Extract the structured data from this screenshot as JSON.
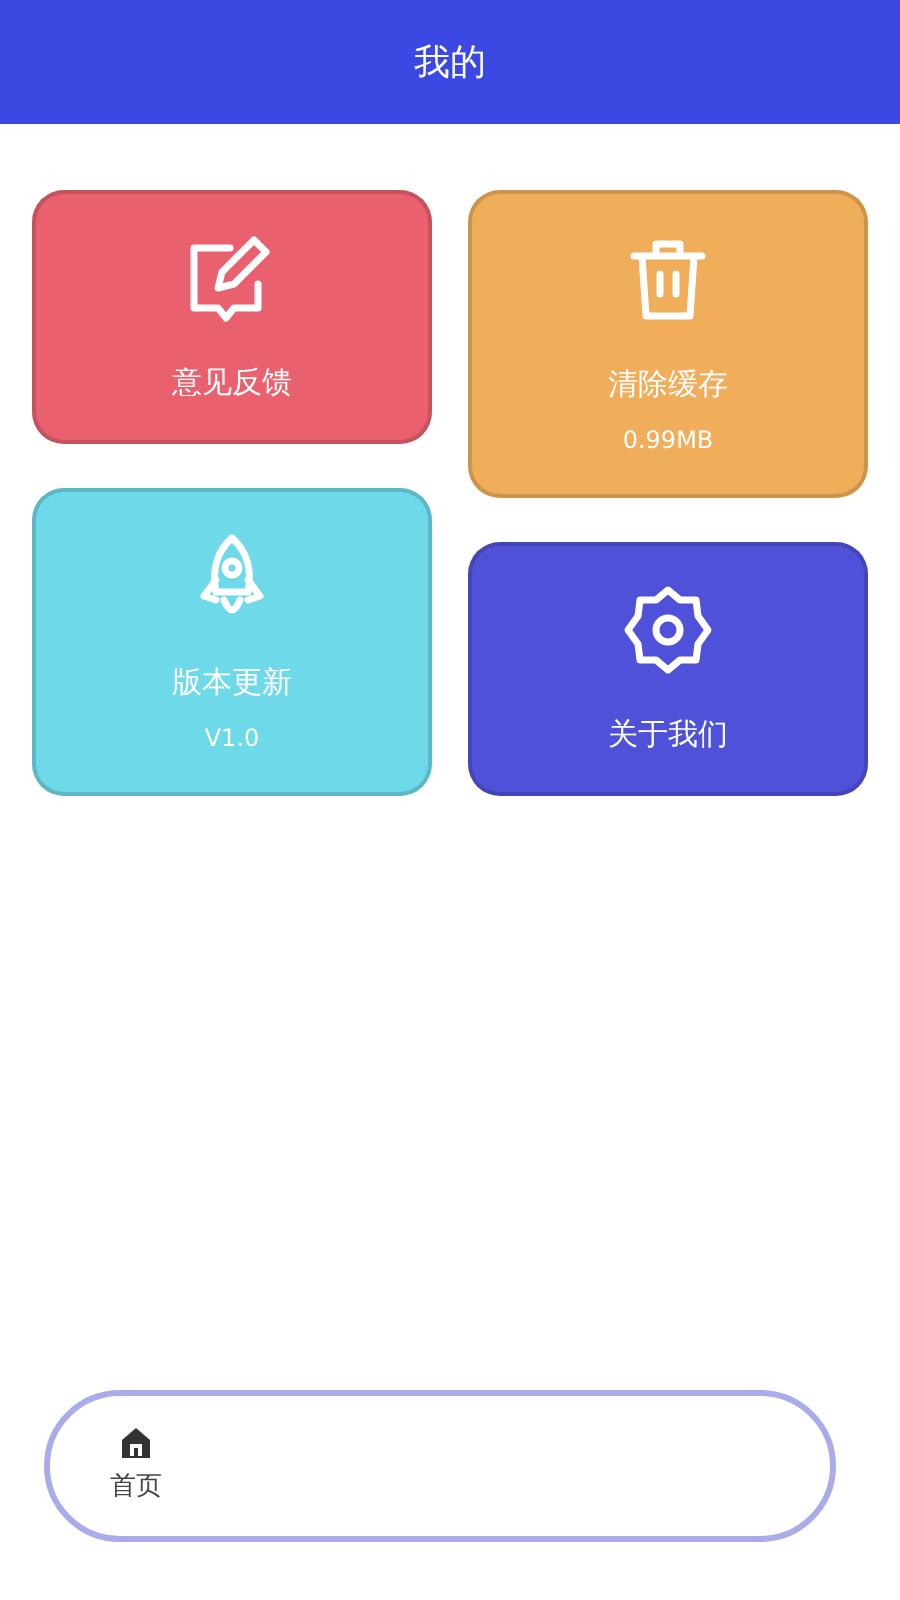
{
  "header": {
    "title": "我的"
  },
  "cards": [
    {
      "title": "意见反馈",
      "color": "#e9616f"
    },
    {
      "title": "版本更新",
      "subtitle": "V1.0",
      "color": "#6dd9e9"
    },
    {
      "title": "清除缓存",
      "subtitle": "0.99MB",
      "color": "#f0ad5a"
    },
    {
      "title": "关于我们",
      "color": "#4f52d9"
    }
  ],
  "tab_bar": {
    "items": [
      {
        "label": "首页"
      }
    ]
  }
}
